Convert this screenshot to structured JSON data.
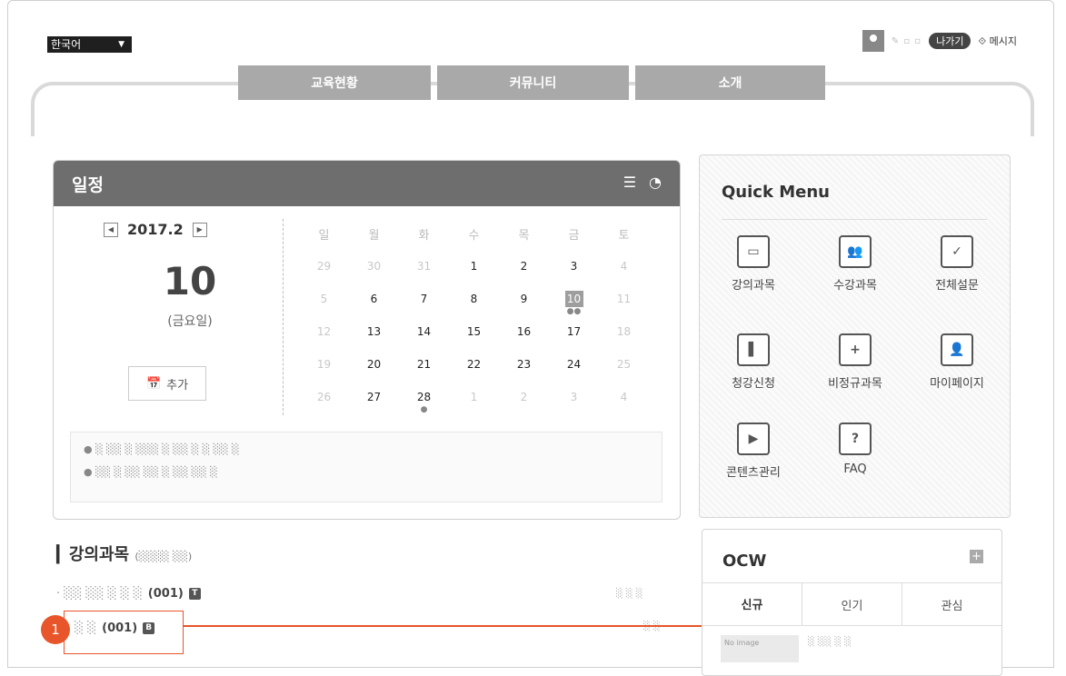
{
  "header": {
    "language": "한국어",
    "logout_label": "나가기",
    "message_label": "메시지"
  },
  "nav": {
    "items": [
      "교육현황",
      "커뮤니티",
      "소개"
    ]
  },
  "schedule": {
    "title": "일정",
    "month": "2017.2",
    "selected_day": "10",
    "selected_weekday": "(금요일)",
    "add_label": "추가",
    "weekday_headers": [
      "일",
      "월",
      "화",
      "수",
      "목",
      "금",
      "토"
    ],
    "weeks": [
      [
        "29",
        "30",
        "31",
        "1",
        "2",
        "3",
        "4"
      ],
      [
        "5",
        "6",
        "7",
        "8",
        "9",
        "10",
        "11"
      ],
      [
        "12",
        "13",
        "14",
        "15",
        "16",
        "17",
        "18"
      ],
      [
        "19",
        "20",
        "21",
        "22",
        "23",
        "24",
        "25"
      ],
      [
        "26",
        "27",
        "28",
        "1",
        "2",
        "3",
        "4"
      ]
    ]
  },
  "quick_menu": {
    "title": "Quick Menu",
    "items": [
      {
        "label": "강의과목",
        "icon": "monitor-icon"
      },
      {
        "label": "수강과목",
        "icon": "book-people-icon"
      },
      {
        "label": "전체설문",
        "icon": "clipboard-check-icon"
      },
      {
        "label": "청강신청",
        "icon": "bookmark-book-icon"
      },
      {
        "label": "비정규과목",
        "icon": "book-plus-icon"
      },
      {
        "label": "마이페이지",
        "icon": "profile-card-icon"
      },
      {
        "label": "콘텐츠관리",
        "icon": "play-gear-icon"
      },
      {
        "label": "FAQ",
        "icon": "question-icon"
      }
    ]
  },
  "lectures": {
    "title": "강의과목",
    "rows": [
      {
        "code": "(001)",
        "badge": "T"
      },
      {
        "code": "(001)",
        "badge": "B"
      }
    ]
  },
  "annotation": {
    "step_number": "1",
    "color": "#e8552a"
  },
  "ocw": {
    "title": "OCW",
    "tabs": [
      "신규",
      "인기",
      "관심"
    ],
    "no_image_label": "No image"
  }
}
